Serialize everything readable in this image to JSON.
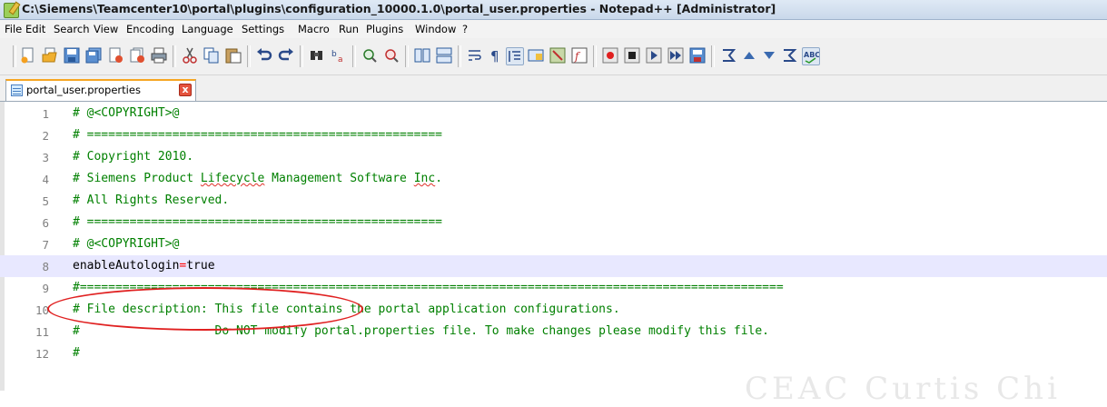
{
  "window": {
    "title": "C:\\Siemens\\Teamcenter10\\portal\\plugins\\configuration_10000.1.0\\portal_user.properties - Notepad++ [Administrator]"
  },
  "menu": [
    "File",
    "Edit",
    "Search",
    "View",
    "Encoding",
    "Language",
    "Settings",
    "Macro",
    "Run",
    "Plugins",
    "Window",
    "?"
  ],
  "toolbar_icons": [
    "new-file-icon",
    "open-file-icon",
    "save-icon",
    "save-all-icon",
    "close-icon",
    "close-all-icon",
    "print-icon",
    "cut-icon",
    "copy-icon",
    "paste-icon",
    "undo-icon",
    "redo-icon",
    "find-icon",
    "replace-icon",
    "zoom-in-icon",
    "zoom-out-icon",
    "sync-vertical-icon",
    "sync-horizontal-icon",
    "word-wrap-icon",
    "show-all-chars-icon",
    "indent-guide-icon",
    "user-defined-lang-icon",
    "doc-map-icon",
    "function-list-icon",
    "record-macro-icon",
    "stop-record-icon",
    "play-macro-icon",
    "run-macro-multiple-icon",
    "save-macro-icon",
    "collapse-icon",
    "up-icon",
    "down-icon",
    "sum-icon",
    "spell-check-icon"
  ],
  "tab": {
    "label": "portal_user.properties",
    "close_symbol": "x"
  },
  "editor": {
    "lines": [
      {
        "n": "1",
        "text": "# @<COPYRIGHT>@"
      },
      {
        "n": "2",
        "text": "# =================================================="
      },
      {
        "n": "3",
        "text": "# Copyright 2010."
      },
      {
        "n": "4",
        "text_a": "# Siemens Product ",
        "text_b": "Lifecycle",
        "text_c": " Management Software ",
        "text_d": "Inc",
        "text_e": "."
      },
      {
        "n": "5",
        "text": "# All Rights Reserved."
      },
      {
        "n": "6",
        "text": "# =================================================="
      },
      {
        "n": "7",
        "text": "# @<COPYRIGHT>@"
      },
      {
        "n": "8",
        "key": "enableAutologin",
        "eq": "=",
        "value": "true"
      },
      {
        "n": "9",
        "text": "#==================================================================================================="
      },
      {
        "n": "10",
        "text": "# File description: This file contains the portal application configurations."
      },
      {
        "n": "11",
        "text": "#                   Do NOT modify portal.properties file. To make changes please modify this file."
      },
      {
        "n": "12",
        "text": "#"
      }
    ]
  },
  "watermark": "CEAC Curtis Chi"
}
